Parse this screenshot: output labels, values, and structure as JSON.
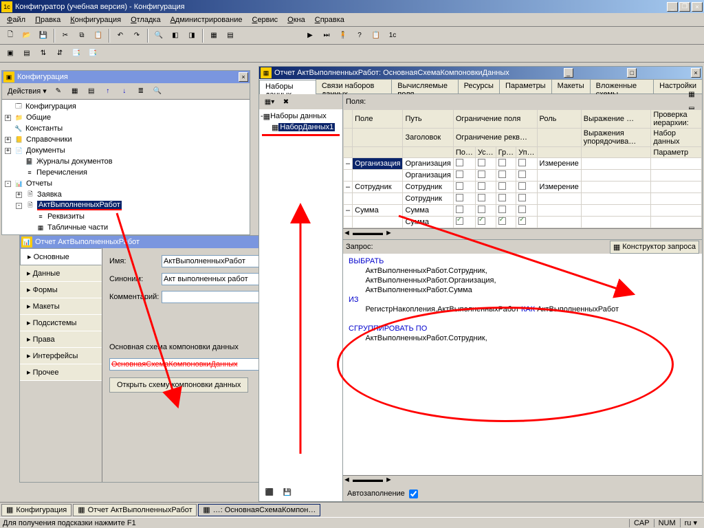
{
  "titlebar": {
    "text": "Конфигуратор (учебная версия) - Конфигурация"
  },
  "menu": [
    "Файл",
    "Правка",
    "Конфигурация",
    "Отладка",
    "Администрирование",
    "Сервис",
    "Окна",
    "Справка"
  ],
  "cfg_win": {
    "title": "Конфигурация",
    "actions": "Действия ▾",
    "tree": [
      {
        "lvl": 0,
        "exp": "",
        "icon": "🗔",
        "label": "Конфигурация"
      },
      {
        "lvl": 0,
        "exp": "+",
        "icon": "📁",
        "label": "Общие"
      },
      {
        "lvl": 0,
        "exp": "",
        "icon": "🔧",
        "label": "Константы"
      },
      {
        "lvl": 0,
        "exp": "+",
        "icon": "📒",
        "label": "Справочники"
      },
      {
        "lvl": 0,
        "exp": "+",
        "icon": "📄",
        "label": "Документы"
      },
      {
        "lvl": 1,
        "exp": "",
        "icon": "📓",
        "label": "Журналы документов"
      },
      {
        "lvl": 1,
        "exp": "",
        "icon": "≡",
        "label": "Перечисления"
      },
      {
        "lvl": 0,
        "exp": "-",
        "icon": "📊",
        "label": "Отчеты"
      },
      {
        "lvl": 1,
        "exp": "+",
        "icon": "🗎",
        "label": "Заявка"
      },
      {
        "lvl": 1,
        "exp": "-",
        "icon": "🗎",
        "label": "АктВыполненныхРабот",
        "sel": true,
        "underline": true
      },
      {
        "lvl": 2,
        "exp": "",
        "icon": "≡",
        "label": "Реквизиты"
      },
      {
        "lvl": 2,
        "exp": "",
        "icon": "▦",
        "label": "Табличные части"
      }
    ]
  },
  "report_win": {
    "title": "Отчет АктВыполненныхРабот",
    "tabs": [
      "Основные",
      "Данные",
      "Формы",
      "Макеты",
      "Подсистемы",
      "Права",
      "Интерфейсы",
      "Прочее"
    ],
    "active_tab": 0,
    "fields": {
      "name_label": "Имя:",
      "name_value": "АктВыполненныхРабот",
      "syn_label": "Синоним:",
      "syn_value": "Акт выполненных работ",
      "comment_label": "Комментарий:",
      "comment_value": "",
      "schema_label": "Основная схема компоновки данных",
      "schema_value": "ОсновнаяСхемаКомпоновкиДанных",
      "open_btn": "Открыть схему компоновки данных"
    }
  },
  "schema_win": {
    "title": "Отчет АктВыполненныхРабот: ОсновнаяСхемаКомпоновкиДанных",
    "tabs": [
      "Наборы данных",
      "Связи наборов данных",
      "Вычисляемые поля",
      "Ресурсы",
      "Параметры",
      "Макеты",
      "Вложенные схемы",
      "Настройки"
    ],
    "ds_root": "Наборы данных",
    "ds_item": "НаборДанных1",
    "fields_label": "Поля:",
    "grid_headers": {
      "c1": "Поле",
      "c2": "Путь",
      "c3": "Ограничение поля",
      "c4": "Роль",
      "c5": "Выражение …",
      "c6": "Проверка иерархии:",
      "r2c2": "Заголовок",
      "r2c3": "Ограничение рекв…",
      "r2c5": "Выражения упорядочива…",
      "r2c6": "Набор данных",
      "r3a": "По…",
      "r3b": "Ус…",
      "r3c": "Гр…",
      "r3d": "Уп…",
      "r3e": "Параметр"
    },
    "rows": [
      {
        "field": "Организация",
        "path1": "Организация",
        "path2": "Организация",
        "role": "Измерение"
      },
      {
        "field": "Сотрудник",
        "path1": "Сотрудник",
        "path2": "Сотрудник",
        "role": "Измерение"
      },
      {
        "field": "Сумма",
        "path1": "Сумма",
        "path2": "Сумма",
        "role": "",
        "checks": true
      }
    ],
    "query_label": "Запрос:",
    "qbtn": "Конструктор запроса",
    "query": {
      "l1": "ВЫБРАТЬ",
      "l2": "        АктВыполненныхРабот.Сотрудник,",
      "l3": "        АктВыполненныхРабот.Организация,",
      "l4": "        АктВыполненныхРабот.Сумма",
      "l5": "ИЗ",
      "l6a": "        РегистрНакопления.АктВыполненныхРабот ",
      "l6b": "КАК",
      "l6c": " АктВыполненныхРабот",
      "l7": "",
      "l8": "СГРУППИРОВАТЬ ПО",
      "l9": "        АктВыполненныхРабот.Сотрудник,"
    },
    "autofill": "Автозаполнение"
  },
  "mdi_tabs": [
    "Конфигурация",
    "Отчет АктВыполненныхРабот",
    "…: ОсновнаяСхемаКомпон…"
  ],
  "statusbar": {
    "hint": "Для получения подсказки нажмите F1",
    "cap": "CAP",
    "num": "NUM",
    "lang": "ru  ▾"
  }
}
